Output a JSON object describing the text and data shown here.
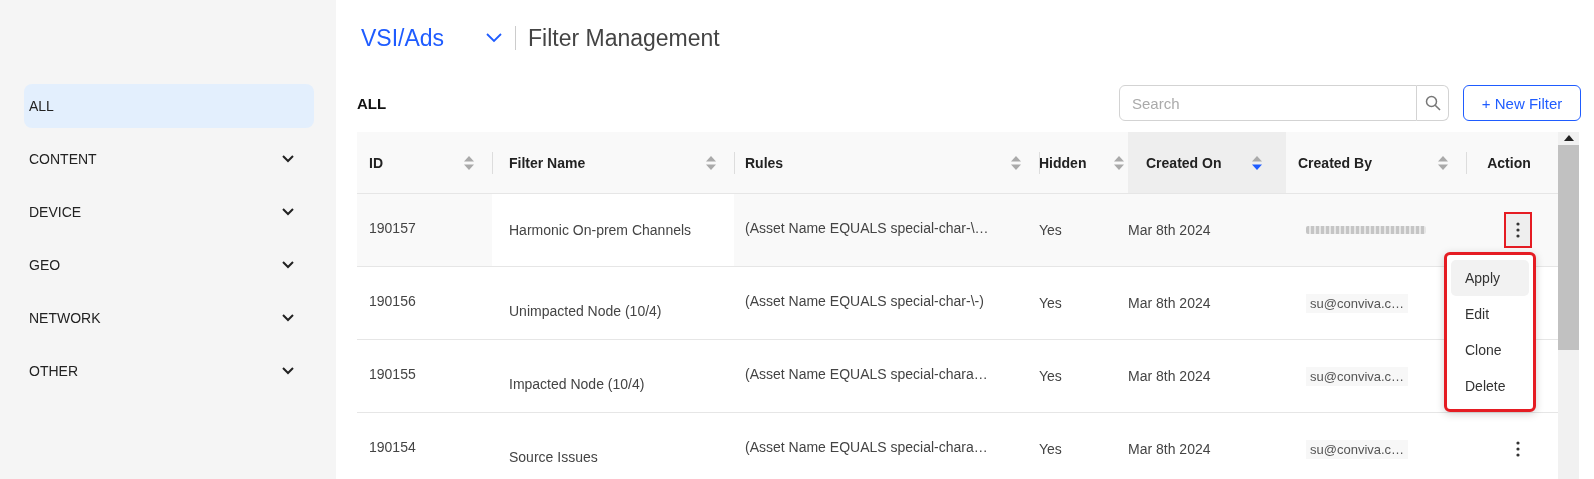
{
  "sidebar": {
    "items": [
      {
        "label": "ALL",
        "kind": "link",
        "selected": true
      },
      {
        "label": "CONTENT",
        "kind": "group",
        "selected": false,
        "expanded": false
      },
      {
        "label": "DEVICE",
        "kind": "group",
        "selected": false,
        "expanded": false
      },
      {
        "label": "GEO",
        "kind": "group",
        "selected": false,
        "expanded": false
      },
      {
        "label": "NETWORK",
        "kind": "group",
        "selected": false,
        "expanded": false
      },
      {
        "label": "OTHER",
        "kind": "group",
        "selected": false,
        "expanded": false
      }
    ]
  },
  "header": {
    "workspace": "VSI/Ads",
    "title": "Filter Management"
  },
  "section_title": "ALL",
  "search": {
    "placeholder": "Search"
  },
  "new_button": "+ New Filter",
  "table": {
    "columns": [
      {
        "label": "ID",
        "sortable": true,
        "sorted": false
      },
      {
        "label": "Filter Name",
        "sortable": true,
        "sorted": false
      },
      {
        "label": "Rules",
        "sortable": true,
        "sorted": false
      },
      {
        "label": "Hidden",
        "sortable": true,
        "sorted": false
      },
      {
        "label": "Created On",
        "sortable": true,
        "sorted": true
      },
      {
        "label": "Created By",
        "sortable": true,
        "sorted": false
      },
      {
        "label": "Action",
        "sortable": false,
        "sorted": false
      }
    ],
    "rows": [
      {
        "id": "190157",
        "name": "Harmonic On-prem Channels",
        "rules": "(Asset Name EQUALS special-char-\\…",
        "hidden": "Yes",
        "created_on": "Mar 8th 2024",
        "created_by_blurred": true,
        "hovered": true,
        "menu_open": true,
        "outlined": true
      },
      {
        "id": "190156",
        "name": "Unimpacted Node (10/4)",
        "rules": "(Asset Name EQUALS special-char-\\-)",
        "hidden": "Yes",
        "created_on": "Mar 8th 2024",
        "created_by": "su@conviva.c…",
        "hovered": false
      },
      {
        "id": "190155",
        "name": "Impacted Node (10/4)",
        "rules": "(Asset Name EQUALS special-chara…",
        "hidden": "Yes",
        "created_on": "Mar 8th 2024",
        "created_by": "su@conviva.c…",
        "hovered": false
      },
      {
        "id": "190154",
        "name": "Source Issues",
        "rules": "(Asset Name EQUALS special-chara…",
        "hidden": "Yes",
        "created_on": "Mar 8th 2024",
        "created_by": "su@conviva.c…",
        "hovered": false,
        "menu_open": false,
        "outlined": false
      }
    ]
  },
  "action_menu": {
    "outlined": true,
    "items": [
      {
        "label": "Apply",
        "hovered": true
      },
      {
        "label": "Edit",
        "hovered": false
      },
      {
        "label": "Clone",
        "hovered": false
      },
      {
        "label": "Delete",
        "hovered": false
      }
    ]
  }
}
